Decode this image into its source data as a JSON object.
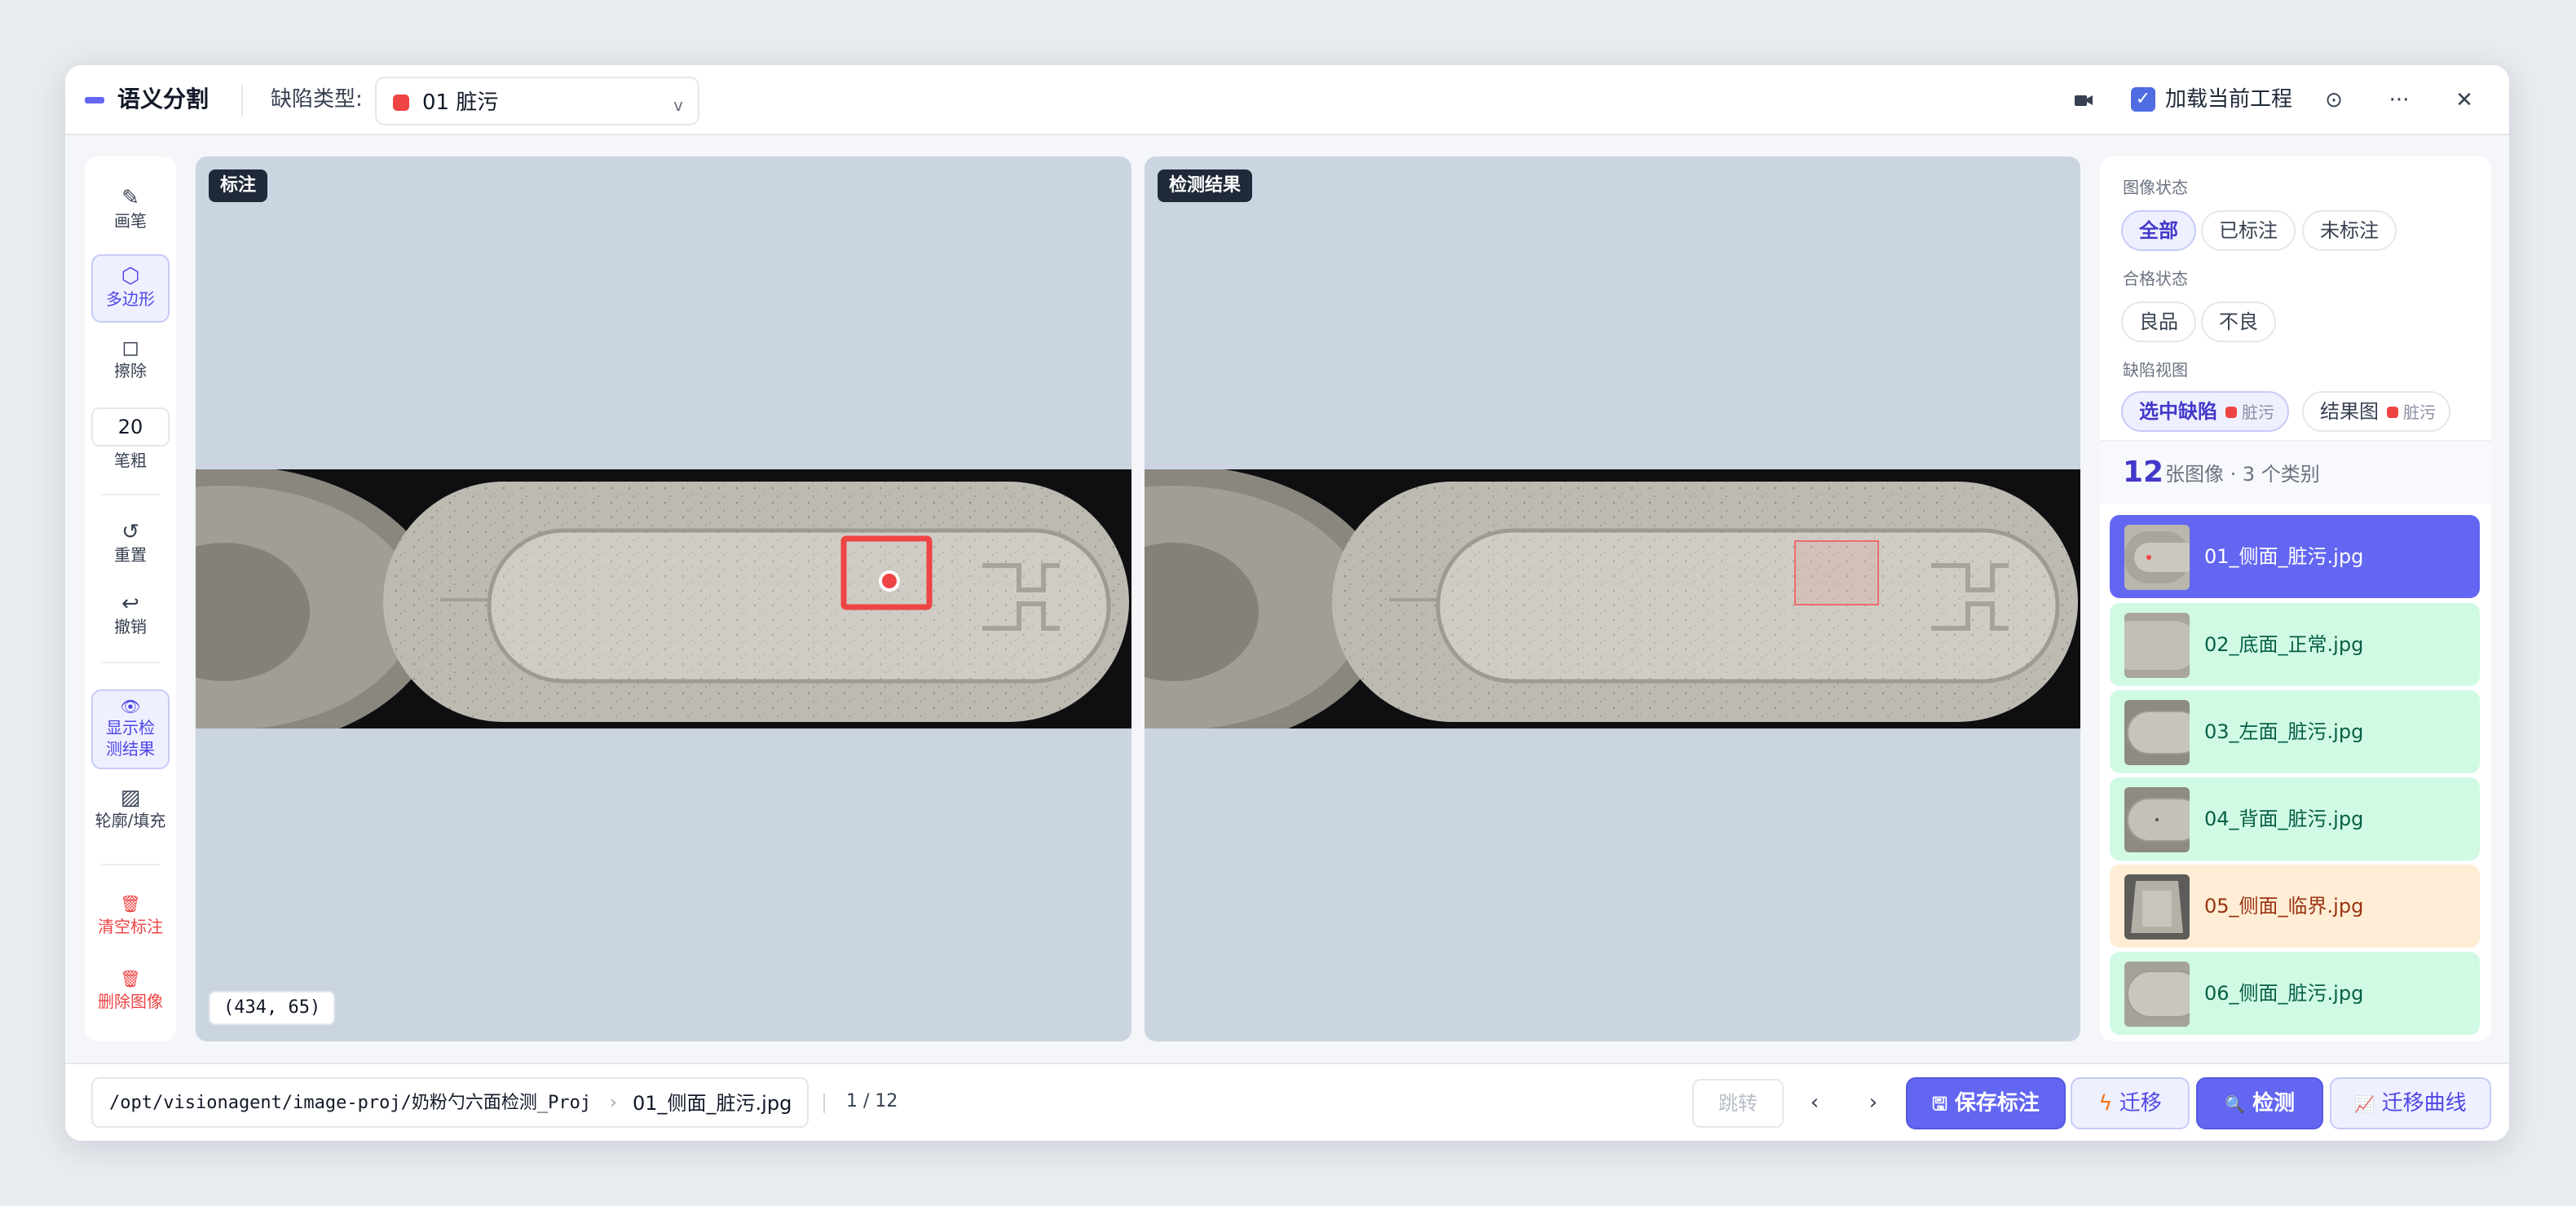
{
  "header": {
    "app_title": "语义分割",
    "defect_type_label": "缺陷类型:",
    "defect_type_value": "01 脏污",
    "defect_type_color": "#ef4444",
    "load_project_label": "加载当前工程",
    "load_project_checked": true,
    "settings_icon": "⊙",
    "more_icon": "···",
    "close_icon": "✕",
    "dropdown_chevron": "v",
    "checkmark": "✓"
  },
  "tools": {
    "brush": {
      "icon": "✎",
      "label": "画笔"
    },
    "polygon": {
      "icon": "⬡",
      "label": "多边形"
    },
    "erase": {
      "icon": "◻",
      "label": "擦除"
    },
    "brush_size_value": "20",
    "brush_size_label": "笔粗",
    "reset": {
      "icon": "↺",
      "label": "重置"
    },
    "undo": {
      "icon": "↩",
      "label": "撤销"
    },
    "show_detection": {
      "icon": "👁",
      "label": "显示检测结果"
    },
    "outline_fill": {
      "icon": "▨",
      "label": "轮廓/填充"
    },
    "clear_annotations": {
      "icon": "🗑",
      "label": "清空标注"
    },
    "delete_image": {
      "icon": "🗑",
      "label": "删除图像"
    }
  },
  "panels": {
    "annotation_title": "标注",
    "detection_title": "检测结果",
    "cursor_coords": "(434, 65)"
  },
  "sidebar": {
    "image_status_label": "图像状态",
    "image_status_options": [
      "全部",
      "已标注",
      "未标注"
    ],
    "quality_status_label": "合格状态",
    "quality_status_options": [
      "良品",
      "不良"
    ],
    "defect_view_label": "缺陷视图",
    "defect_view_selected": "选中缺陷",
    "defect_view_result": "结果图",
    "defect_tag": "脏污",
    "image_count": "12",
    "count_text": "张图像 · 3 个类别",
    "files": [
      {
        "name": "01_侧面_脏污.jpg",
        "status": "selected"
      },
      {
        "name": "02_底面_正常.jpg",
        "status": "good"
      },
      {
        "name": "03_左面_脏污.jpg",
        "status": "good"
      },
      {
        "name": "04_背面_脏污.jpg",
        "status": "good"
      },
      {
        "name": "05_侧面_临界.jpg",
        "status": "borderline"
      },
      {
        "name": "06_侧面_脏污.jpg",
        "status": "good"
      }
    ]
  },
  "footer": {
    "path": "/opt/visionagent/image-proj/奶粉勺六面检测_Proj",
    "path_sep": "›",
    "current_file": "01_侧面_脏污.jpg",
    "page_indicator": "1 / 12",
    "jump_label": "跳转",
    "prev_icon": "‹",
    "next_icon": "›",
    "save_label": "保存标注",
    "save_icon": "🖫",
    "transfer_label": "迁移",
    "transfer_icon": "ϟ",
    "detect_label": "检测",
    "detect_icon": "🔍",
    "curve_label": "迁移曲线",
    "curve_icon": "📈"
  },
  "colors": {
    "accent": "#6366f1",
    "good_row": "#d1fae5",
    "warn_row": "#ffedd5",
    "defect_red": "#ef4444"
  }
}
